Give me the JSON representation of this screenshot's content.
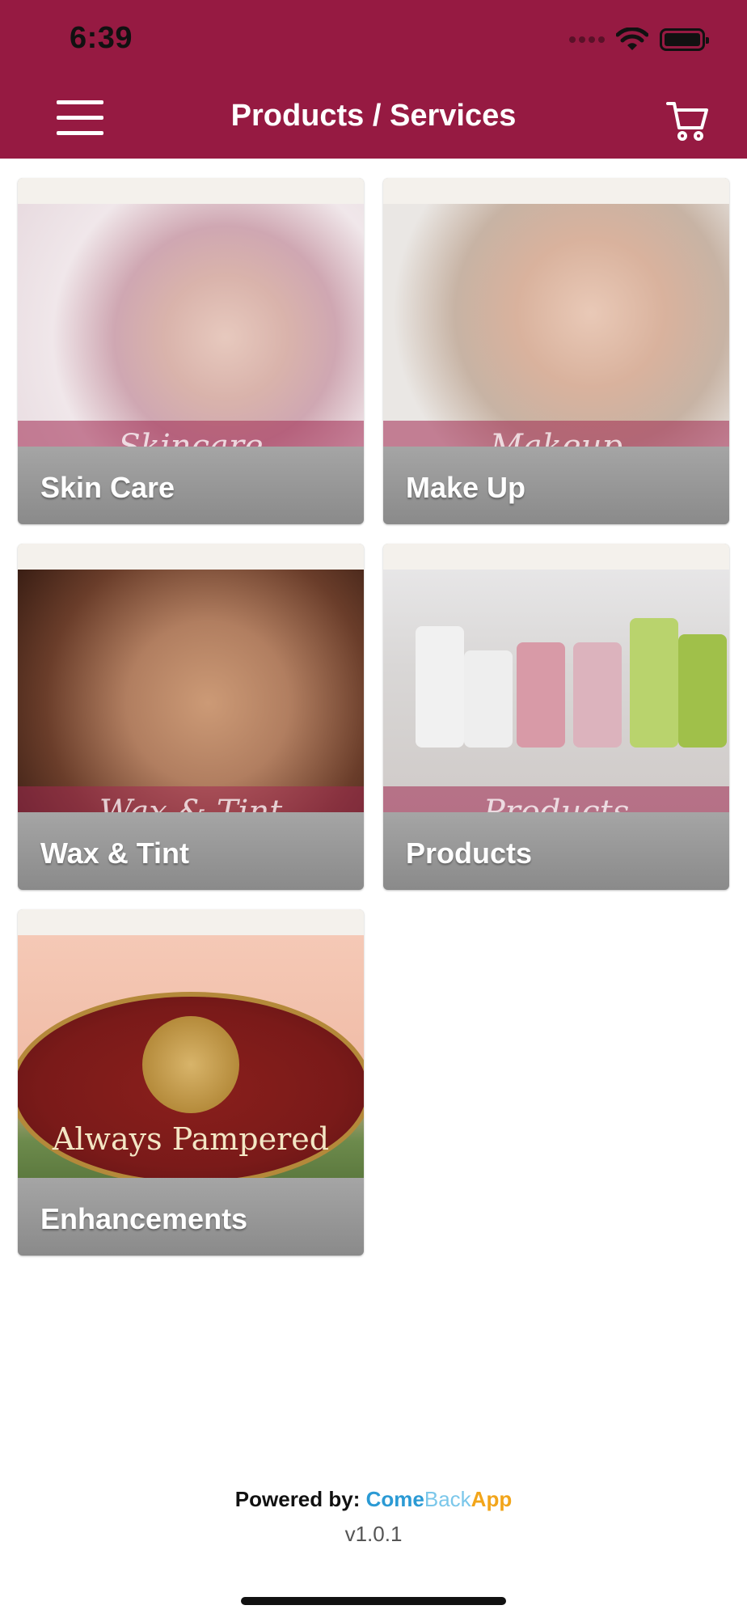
{
  "status_bar": {
    "time": "6:39"
  },
  "header": {
    "title": "Products / Services",
    "accent_color": "#961a42"
  },
  "tiles": [
    {
      "label": "Skin Care",
      "image_caption": "Skincare"
    },
    {
      "label": "Make Up",
      "image_caption": "Makeup"
    },
    {
      "label": "Wax & Tint",
      "image_caption": "Wax & Tint"
    },
    {
      "label": "Products",
      "image_caption": "Products"
    },
    {
      "label": "Enhancements",
      "image_caption": "Always Pampered"
    }
  ],
  "footer": {
    "powered_label": "Powered by:",
    "brand_come": "Come",
    "brand_back": "Back",
    "brand_app": "App",
    "version": "v1.0.1"
  }
}
